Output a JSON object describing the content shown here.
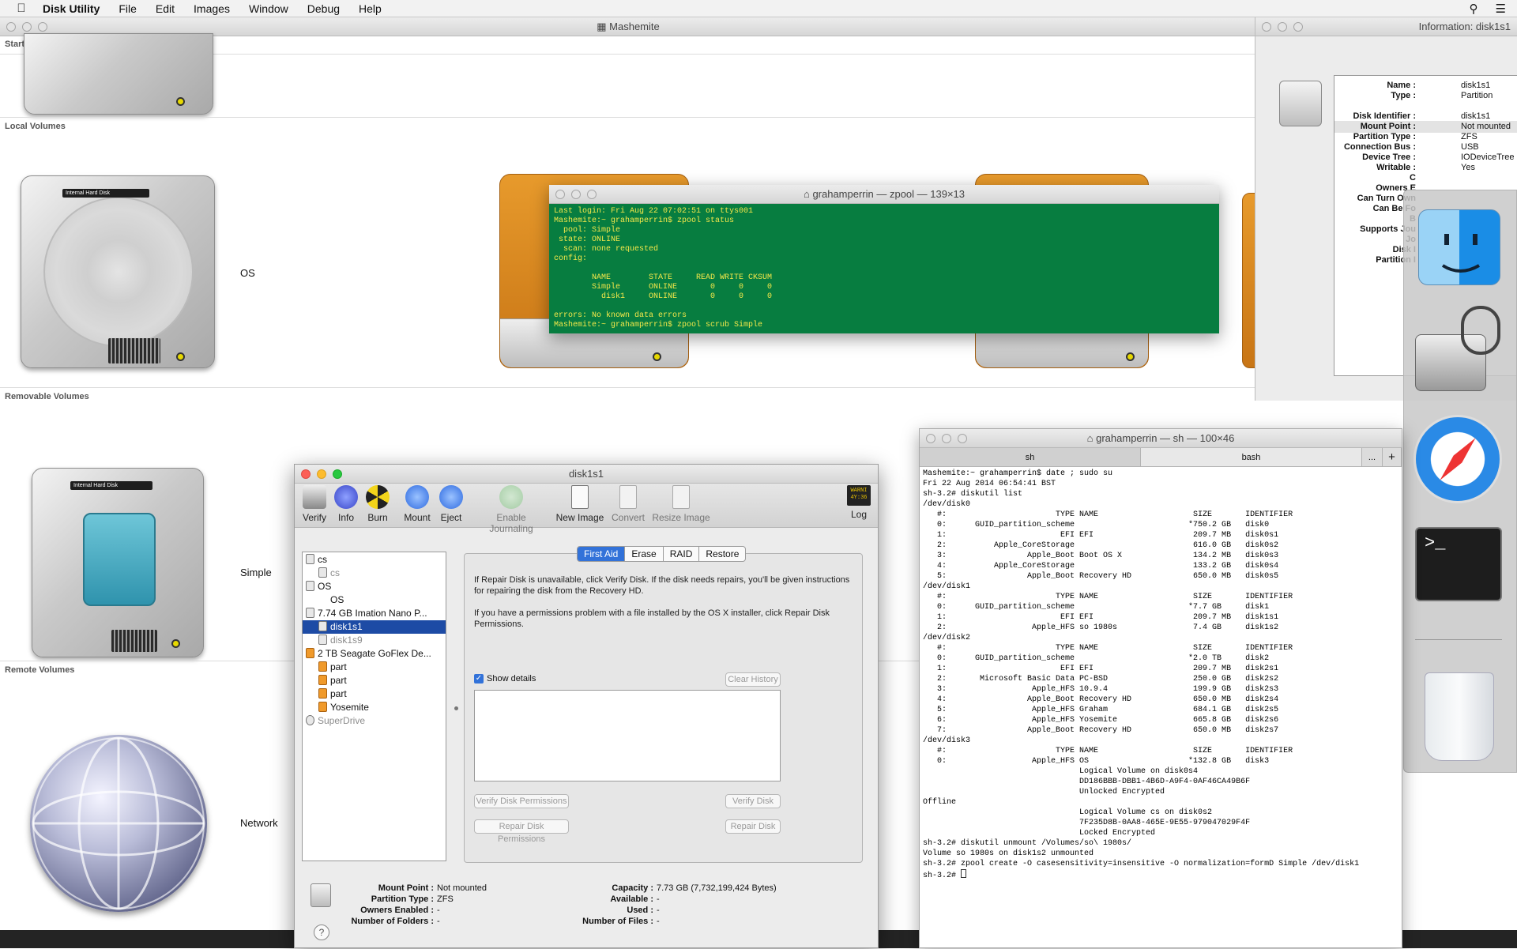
{
  "menubar": {
    "app": "Disk Utility",
    "items": [
      "File",
      "Edit",
      "Images",
      "Window",
      "Debug",
      "Help"
    ]
  },
  "main_window": {
    "title": "Mashemite",
    "sections": {
      "startup": "Startup Volume",
      "local": "Local Volumes",
      "removable": "Removable Volumes",
      "remote": "Remote Volumes"
    },
    "volumes": {
      "os": "OS",
      "simple": "Simple",
      "network": "Network"
    },
    "drive_label": "Internal Hard Disk"
  },
  "zpool_terminal": {
    "title": "grahamperrin — zpool — 139×13",
    "text": "Last login: Fri Aug 22 07:02:51 on ttys001\nMashemite:~ grahamperrin$ zpool status\n  pool: Simple\n state: ONLINE\n  scan: none requested\nconfig:\n\n\tNAME        STATE     READ WRITE CKSUM\n\tSimple      ONLINE       0     0     0\n\t  disk1     ONLINE       0     0     0\n\nerrors: No known data errors\nMashemite:~ grahamperrin$ zpool scrub Simple"
  },
  "info_window": {
    "title": "Information: disk1s1",
    "rows": [
      {
        "k": "Name :",
        "v": "disk1s1"
      },
      {
        "k": "Type :",
        "v": "Partition"
      },
      {
        "k": "Disk Identifier :",
        "v": "disk1s1"
      },
      {
        "k": "Mount Point :",
        "v": "Not mounted"
      },
      {
        "k": "Partition Type :",
        "v": "ZFS"
      },
      {
        "k": "Connection Bus :",
        "v": "USB"
      },
      {
        "k": "Device Tree :",
        "v": "IODeviceTree"
      },
      {
        "k": "Writable :",
        "v": "Yes"
      },
      {
        "k": "C",
        "v": ""
      },
      {
        "k": "Owners E",
        "v": ""
      },
      {
        "k": "Can Turn Own",
        "v": ""
      },
      {
        "k": "Can Be Fo",
        "v": ""
      },
      {
        "k": "B",
        "v": ""
      },
      {
        "k": "Supports Jou",
        "v": ""
      },
      {
        "k": "Jo",
        "v": ""
      },
      {
        "k": "Disk I",
        "v": ""
      },
      {
        "k": "Partition I",
        "v": ""
      }
    ]
  },
  "sh_terminal": {
    "title": "grahamperrin — sh — 100×46",
    "tabs": [
      "sh",
      "bash"
    ],
    "tab_more": "...",
    "tab_add": "+",
    "text": "Mashemite:~ grahamperrin$ date ; sudo su\nFri 22 Aug 2014 06:54:41 BST\nsh-3.2# diskutil list\n/dev/disk0\n   #:                       TYPE NAME                    SIZE       IDENTIFIER\n   0:      GUID_partition_scheme                        *750.2 GB   disk0\n   1:                        EFI EFI                     209.7 MB   disk0s1\n   2:          Apple_CoreStorage                         616.0 GB   disk0s2\n   3:                 Apple_Boot Boot OS X               134.2 MB   disk0s3\n   4:          Apple_CoreStorage                         133.2 GB   disk0s4\n   5:                 Apple_Boot Recovery HD             650.0 MB   disk0s5\n/dev/disk1\n   #:                       TYPE NAME                    SIZE       IDENTIFIER\n   0:      GUID_partition_scheme                        *7.7 GB     disk1\n   1:                        EFI EFI                     209.7 MB   disk1s1\n   2:                  Apple_HFS so 1980s                7.4 GB     disk1s2\n/dev/disk2\n   #:                       TYPE NAME                    SIZE       IDENTIFIER\n   0:      GUID_partition_scheme                        *2.0 TB     disk2\n   1:                        EFI EFI                     209.7 MB   disk2s1\n   2:       Microsoft Basic Data PC-BSD                  250.0 GB   disk2s2\n   3:                  Apple_HFS 10.9.4                  199.9 GB   disk2s3\n   4:                 Apple_Boot Recovery HD             650.0 MB   disk2s4\n   5:                  Apple_HFS Graham                  684.1 GB   disk2s5\n   6:                  Apple_HFS Yosemite                665.8 GB   disk2s6\n   7:                 Apple_Boot Recovery HD             650.0 MB   disk2s7\n/dev/disk3\n   #:                       TYPE NAME                    SIZE       IDENTIFIER\n   0:                  Apple_HFS OS                     *132.8 GB   disk3\n                                 Logical Volume on disk0s4\n                                 DD186BBB-DBB1-4B6D-A9F4-0AF46CA49B6F\n                                 Unlocked Encrypted\nOffline\n                                 Logical Volume cs on disk0s2\n                                 7F235D8B-0AA8-465E-9E55-979047029F4F\n                                 Locked Encrypted\nsh-3.2# diskutil unmount /Volumes/so\\ 1980s/\nVolume so 1980s on disk1s2 unmounted\nsh-3.2# zpool create -O casesensitivity=insensitive -O normalization=formD Simple /dev/disk1\nsh-3.2# "
  },
  "du_window": {
    "title": "disk1s1",
    "toolbar": [
      "Verify",
      "Info",
      "Burn",
      "Mount",
      "Eject",
      "Enable Journaling",
      "New Image",
      "Convert",
      "Resize Image",
      "Log"
    ],
    "log_icon_text": "WARNI\n4Y:36",
    "sidebar": [
      {
        "label": "cs",
        "indent": 0,
        "state": "normal",
        "icon": "disk"
      },
      {
        "label": "cs",
        "indent": 1,
        "state": "dim",
        "icon": "disk"
      },
      {
        "label": "OS",
        "indent": 0,
        "state": "normal",
        "icon": "disk"
      },
      {
        "label": "OS",
        "indent": 1,
        "state": "normal",
        "icon": "none"
      },
      {
        "label": "7.74 GB Imation Nano P...",
        "indent": 0,
        "state": "normal",
        "icon": "disk"
      },
      {
        "label": "disk1s1",
        "indent": 1,
        "state": "selected",
        "icon": "disk"
      },
      {
        "label": "disk1s9",
        "indent": 1,
        "state": "dim",
        "icon": "disk"
      },
      {
        "label": "2 TB Seagate GoFlex De...",
        "indent": 0,
        "state": "normal",
        "icon": "orange"
      },
      {
        "label": "part",
        "indent": 1,
        "state": "normal",
        "icon": "orange"
      },
      {
        "label": "part",
        "indent": 1,
        "state": "normal",
        "icon": "orange"
      },
      {
        "label": "part",
        "indent": 1,
        "state": "normal",
        "icon": "orange"
      },
      {
        "label": "Yosemite",
        "indent": 1,
        "state": "normal",
        "icon": "orange"
      },
      {
        "label": "SuperDrive",
        "indent": 0,
        "state": "dim",
        "icon": "optical"
      }
    ],
    "tabs": [
      "First Aid",
      "Erase",
      "RAID",
      "Restore"
    ],
    "active_tab": "First Aid",
    "para1": "If Repair Disk is unavailable, click Verify Disk. If the disk needs repairs, you'll be given instructions for repairing the disk from the Recovery HD.",
    "para2": "If you have a permissions problem with a file installed by the OS X installer, click Repair Disk Permissions.",
    "show_details": "Show details",
    "clear_history": "Clear History",
    "verify_permissions": "Verify Disk Permissions",
    "verify_disk": "Verify Disk",
    "repair_permissions": "Repair Disk Permissions",
    "repair_disk": "Repair Disk",
    "info_left": [
      {
        "k": "Mount Point :",
        "v": "Not mounted"
      },
      {
        "k": "Partition Type :",
        "v": "ZFS"
      },
      {
        "k": "Owners Enabled :",
        "v": "-"
      },
      {
        "k": "Number of Folders :",
        "v": "-"
      }
    ],
    "info_right": [
      {
        "k": "Capacity :",
        "v": "7.73 GB (7,732,199,424 Bytes)"
      },
      {
        "k": "Available :",
        "v": "-"
      },
      {
        "k": "Used :",
        "v": "-"
      },
      {
        "k": "Number of Files :",
        "v": "-"
      }
    ],
    "help": "?"
  },
  "dock": {
    "apps": [
      "finder-icon",
      "disk-utility-icon",
      "safari-icon",
      "terminal-icon",
      "trash-icon"
    ],
    "terminal_prompt": ">_"
  }
}
